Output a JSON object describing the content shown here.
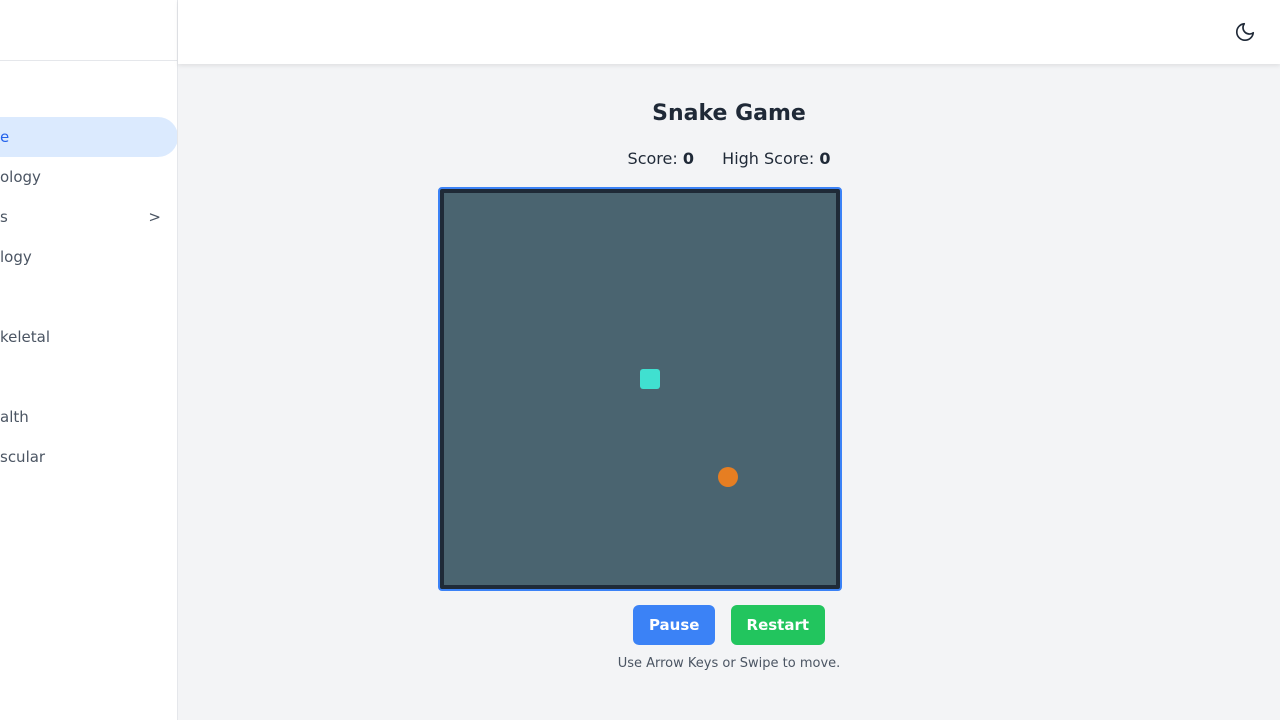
{
  "sidebar": {
    "items": [
      {
        "label": "e",
        "active": true
      },
      {
        "label": "ology"
      },
      {
        "label": "s",
        "has_submenu": true,
        "chevron": ">"
      },
      {
        "label": "logy"
      },
      {
        "label": ""
      },
      {
        "label": "keletal"
      },
      {
        "label": ""
      },
      {
        "label": "alth"
      },
      {
        "label": "scular"
      }
    ]
  },
  "header": {
    "theme_toggle_icon": "moon-icon"
  },
  "game": {
    "title": "Snake Game",
    "score_label": "Score:",
    "score": "0",
    "high_score_label": "High Score:",
    "high_score": "0",
    "pause_label": "Pause",
    "restart_label": "Restart",
    "hint": "Use Arrow Keys or Swipe to move.",
    "colors": {
      "board": "#4a6470",
      "snake": "#40e0d0",
      "food": "#e67e22",
      "border": "#3b82f6"
    }
  }
}
